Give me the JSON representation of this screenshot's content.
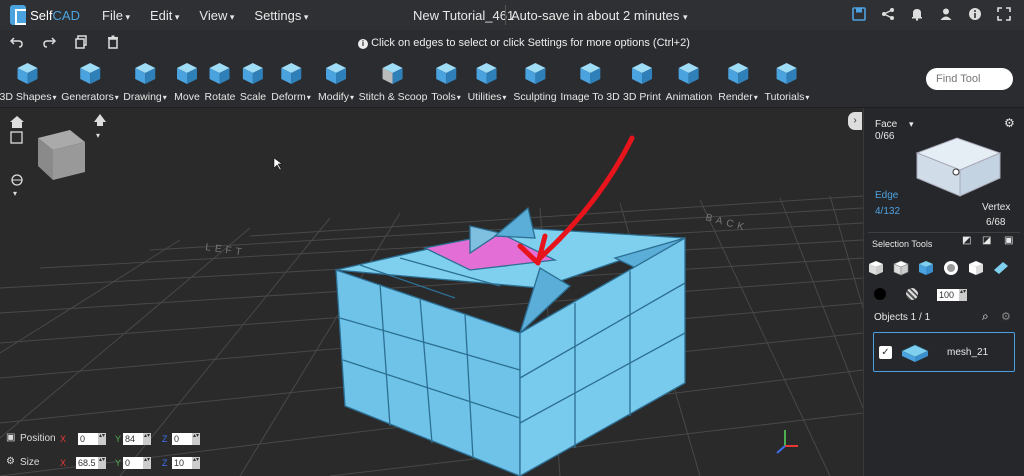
{
  "app": {
    "logo_prefix": "Self",
    "logo_suffix": "CAD"
  },
  "menu": [
    "File",
    "Edit",
    "View",
    "Settings"
  ],
  "document": {
    "title": "New Tutorial_461",
    "autosave": "Auto-save in about 2 minutes"
  },
  "top_icons": [
    "save-icon",
    "share-icon",
    "bell-icon",
    "user-icon",
    "info-icon",
    "fullscreen-icon"
  ],
  "history_icons": [
    "undo-icon",
    "redo-icon",
    "copy-icon",
    "trash-icon"
  ],
  "hint": "Click on edges to select or click Settings for more options (Ctrl+2)",
  "toolbar": {
    "tools": [
      {
        "label": "3D Shapes",
        "dropdown": true
      },
      {
        "label": "Generators",
        "dropdown": true
      },
      {
        "label": "Drawing",
        "dropdown": true
      },
      {
        "label": "Move",
        "dropdown": false
      },
      {
        "label": "Rotate",
        "dropdown": false
      },
      {
        "label": "Scale",
        "dropdown": false
      },
      {
        "label": "Deform",
        "dropdown": true
      },
      {
        "label": "Modify",
        "dropdown": true
      },
      {
        "label": "Stitch & Scoop",
        "dropdown": false
      },
      {
        "label": "Tools",
        "dropdown": true
      },
      {
        "label": "Utilities",
        "dropdown": true
      },
      {
        "label": "Sculpting",
        "dropdown": false
      },
      {
        "label": "Image To 3D",
        "dropdown": false
      },
      {
        "label": "3D Print",
        "dropdown": false
      },
      {
        "label": "Animation",
        "dropdown": false
      },
      {
        "label": "Render",
        "dropdown": true
      },
      {
        "label": "Tutorials",
        "dropdown": true
      }
    ],
    "find_placeholder": "Find Tool"
  },
  "viewport": {
    "grid_labels": {
      "left": "LEFT",
      "back": "BACK"
    },
    "colors": {
      "mesh": "#6fc3e8",
      "mesh_edge": "#2c6f93",
      "selected_face": "#e36fd6",
      "arrow": "#e8141b",
      "grid": "#4a4a4a"
    }
  },
  "panel": {
    "mode": "Face",
    "face_count": "0/66",
    "edge_label": "Edge",
    "edge_count": "4/132",
    "vertex_label": "Vertex",
    "vertex_count": "6/68",
    "selection_tools_label": "Selection Tools",
    "brush_size": "100",
    "objects_label": "Objects 1 / 1",
    "object_name": "mesh_21"
  },
  "transform": {
    "position_label": "Position",
    "size_label": "Size",
    "position": {
      "x": "0",
      "y": "84",
      "z": "0"
    },
    "size": {
      "x": "68.5",
      "y": "0",
      "z": "10"
    },
    "axis_labels": [
      "X",
      "Y",
      "Z"
    ]
  }
}
